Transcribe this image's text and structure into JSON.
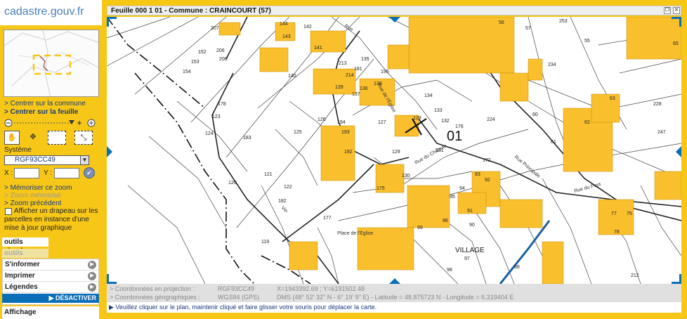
{
  "logo": {
    "text": "cadastre.gouv.fr"
  },
  "title": "Feuille 000 1 01 - Commune : CRAINCOURT (57)",
  "sidebar": {
    "links": {
      "center_commune": "> Centrer sur la commune",
      "center_sheet": "> Centrer sur la feuille",
      "memorize_zoom": "> Mémoriser ce zoom",
      "memorized_zoom": "> Zoom mémorisé",
      "previous_zoom": "> Zoom précédent"
    },
    "systeme_label": "Système",
    "systeme_value": "RGF93CC49",
    "x_label": "X :",
    "y_label": "Y :",
    "x_value": "",
    "y_value": "",
    "flag_text": "Afficher un drapeau sur les parcelles en instance d'une mise à jour graphique",
    "tabs": {
      "simple": "outils simples",
      "advanced": "outils avancés"
    },
    "tools": [
      "S'informer",
      "Imprimer",
      "Légendes"
    ],
    "deactivate": "▶ DÉSACTIVER",
    "display": "Affichage"
  },
  "map": {
    "sheet_label": "01",
    "village_label": "VILLAGE",
    "parcels": [
      {
        "n": "207"
      },
      {
        "n": "206"
      },
      {
        "n": "208"
      },
      {
        "n": "152"
      },
      {
        "n": "153"
      },
      {
        "n": "154"
      },
      {
        "n": "144"
      },
      {
        "n": "142"
      },
      {
        "n": "143"
      },
      {
        "n": "141"
      },
      {
        "n": "140"
      },
      {
        "n": "135"
      },
      {
        "n": "213"
      },
      {
        "n": "214"
      },
      {
        "n": "181"
      },
      {
        "n": "195"
      },
      {
        "n": "139"
      },
      {
        "n": "137"
      },
      {
        "n": "136"
      },
      {
        "n": "138"
      },
      {
        "n": "134"
      },
      {
        "n": "133"
      },
      {
        "n": "128"
      },
      {
        "n": "132"
      },
      {
        "n": "176"
      },
      {
        "n": "127"
      },
      {
        "n": "126"
      },
      {
        "n": "129"
      },
      {
        "n": "131"
      },
      {
        "n": "194"
      },
      {
        "n": "193"
      },
      {
        "n": "192"
      },
      {
        "n": "125"
      },
      {
        "n": "123"
      },
      {
        "n": "124"
      },
      {
        "n": "178"
      },
      {
        "n": "183"
      },
      {
        "n": "121"
      },
      {
        "n": "122"
      },
      {
        "n": "120"
      },
      {
        "n": "182"
      },
      {
        "n": "177"
      },
      {
        "n": "119"
      },
      {
        "n": "130"
      },
      {
        "n": "175"
      },
      {
        "n": "172"
      },
      {
        "n": "93"
      },
      {
        "n": "92"
      },
      {
        "n": "94"
      },
      {
        "n": "95"
      },
      {
        "n": "91"
      },
      {
        "n": "96"
      },
      {
        "n": "90"
      },
      {
        "n": "99"
      },
      {
        "n": "97"
      },
      {
        "n": "98"
      },
      {
        "n": "88"
      },
      {
        "n": "56"
      },
      {
        "n": "57"
      },
      {
        "n": "253"
      },
      {
        "n": "55"
      },
      {
        "n": "234"
      },
      {
        "n": "224"
      },
      {
        "n": "60"
      },
      {
        "n": "61"
      },
      {
        "n": "62"
      },
      {
        "n": "63"
      },
      {
        "n": "228"
      },
      {
        "n": "247"
      },
      {
        "n": "65"
      },
      {
        "n": "77"
      },
      {
        "n": "75"
      },
      {
        "n": "78"
      },
      {
        "n": "212"
      }
    ],
    "streets": [
      "Rue",
      "Rue de l'Église",
      "Rue du Château",
      "Rue Principale",
      "Rue du Pont",
      "Place de l'Église",
      "Vin"
    ]
  },
  "info": {
    "projection_label": "> Coordonnées en projection :",
    "projection_system": "RGF93CC49",
    "projection_values": "X=1943392.69 ; Y=6191502.48",
    "geo_label": "> Coordonnées géographiques :",
    "geo_system": "WGS84 (GPS)",
    "geo_values": "DMS (48° 52' 32'' N - 6° 19' 9'' E) - Latitude = 48.875723 N - Longitude = 6.319404 E"
  },
  "hint": "▶ Veuillez cliquer sur le plan, maintenir cliqué et faire glisser votre souris pour déplacer la carte.",
  "colors": {
    "frame": "#f7c718",
    "building": "#f9bf2d",
    "link": "#1a3a7a",
    "deactivate": "#0a6fb8",
    "info_bar": "#e0e0e0"
  }
}
